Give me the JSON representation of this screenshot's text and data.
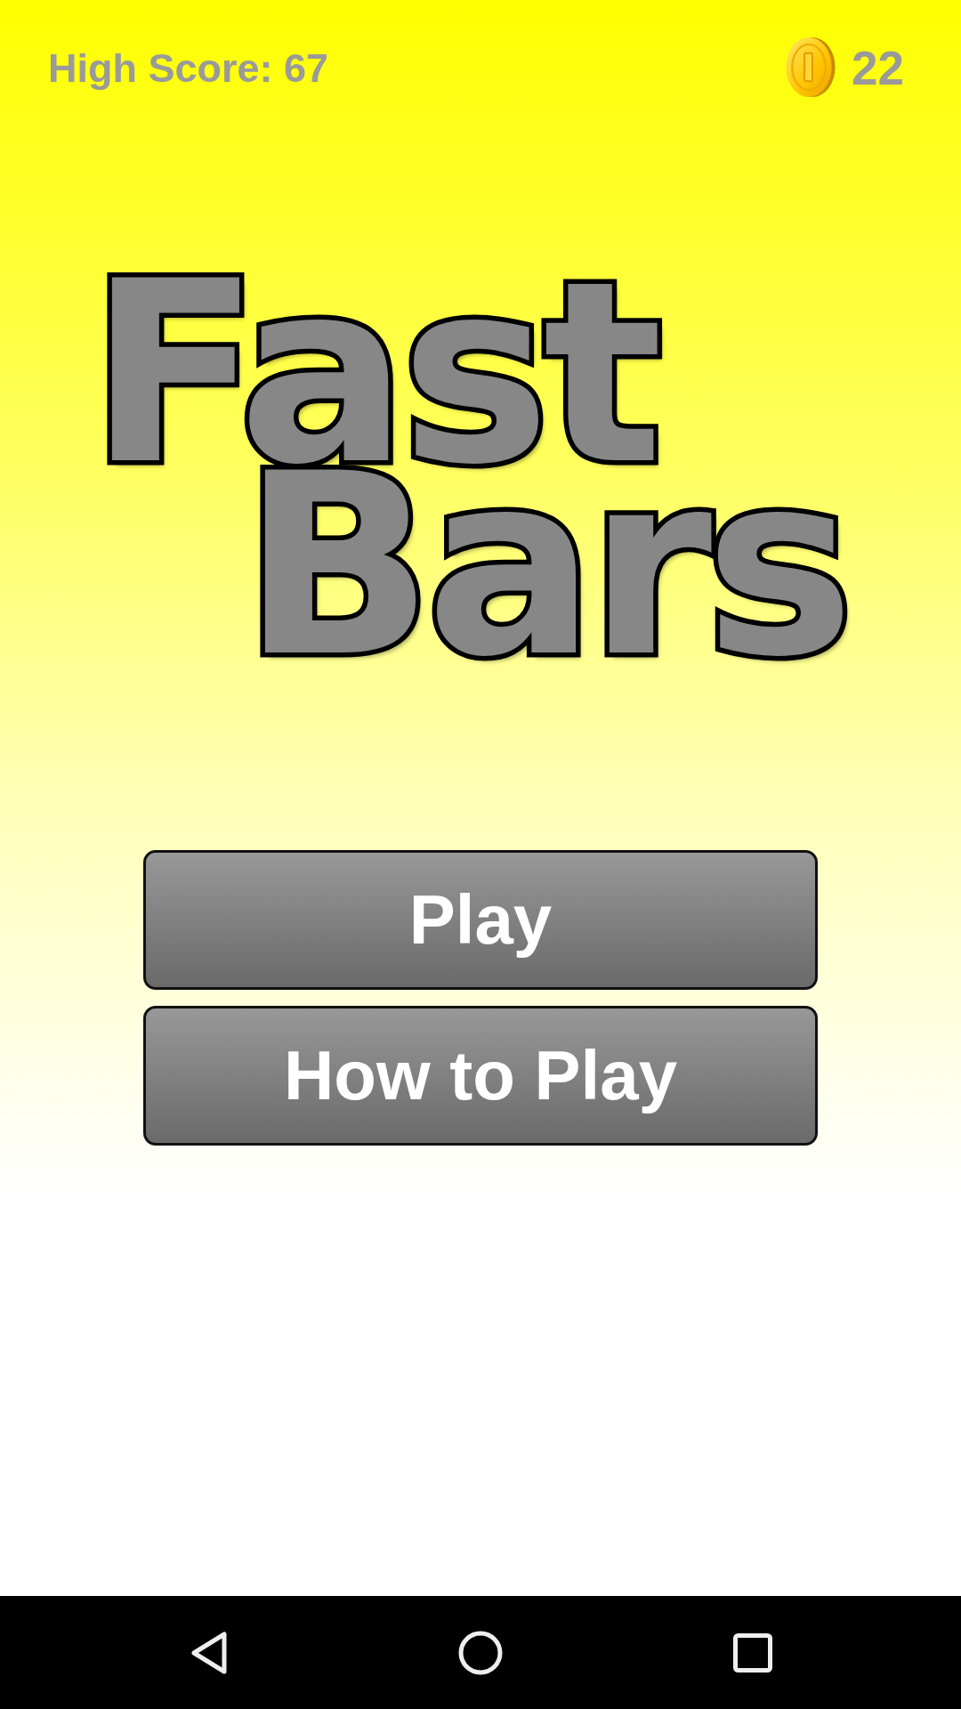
{
  "header": {
    "high_score": "High Score: 67",
    "coins": "22"
  },
  "title_lines": [
    "Fast",
    "Bars"
  ],
  "buttons": [
    {
      "label": "Play"
    },
    {
      "label": "How to Play"
    }
  ]
}
